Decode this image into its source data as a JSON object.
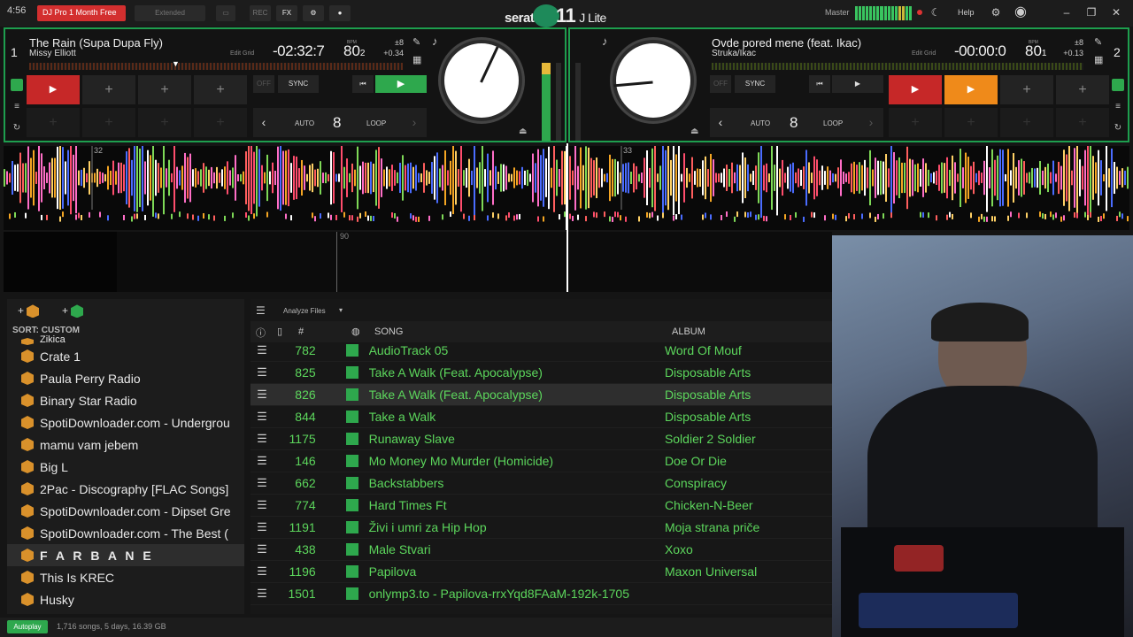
{
  "topbar": {
    "time": "4:56",
    "promo": "DJ Pro 1 Month Free",
    "extended": "Extended",
    "rec": "REC",
    "fx": "FX",
    "logo": "serato",
    "logo_num": "11",
    "logo_suffix": "J Lite",
    "master": "Master",
    "help": "Help"
  },
  "deck1": {
    "number": "1",
    "title": "The Rain (Supa Dupa Fly)",
    "artist": "Missy Elliott",
    "edit_grid": "Edit Grid",
    "time": "-02:32:7",
    "bpm_label": "BPM",
    "bpm": "80",
    "bpm_sub": "2",
    "pitch_range": "±8",
    "pitch": "+0.34",
    "sync": "SYNC",
    "off": "OFF",
    "auto": "AUTO",
    "loop_size": "8",
    "loop": "LOOP"
  },
  "deck2": {
    "number": "2",
    "title": "Ovde pored mene (feat. Ikac)",
    "artist": "Struka/Ikac",
    "edit_grid": "Edit Grid",
    "time": "-00:00:0",
    "bpm_label": "BPM",
    "bpm": "80",
    "bpm_sub": "1",
    "pitch_range": "±8",
    "pitch": "+0.13",
    "sync": "SYNC",
    "off": "OFF",
    "auto": "AUTO",
    "loop_size": "8",
    "loop": "LOOP"
  },
  "wave": {
    "bar1": "32",
    "bar2": "33",
    "mark": "90"
  },
  "library": {
    "sort": "SORT: CUSTOM",
    "analyze": "Analyze Files",
    "crates": [
      "Zikica",
      "Crate 1",
      "Paula Perry Radio",
      "Binary Star Radio",
      "SpotiDownloader.com - Undergrou",
      "mamu vam jebem",
      "Big L",
      "2Pac - Discography [FLAC Songs]",
      "SpotiDownloader.com - Dipset Gre",
      "SpotiDownloader.com - The Best (",
      "F A R B A N E",
      "This Is KREC",
      "Husky"
    ],
    "columns": {
      "num": "#",
      "song": "SONG",
      "album": "ALBUM"
    },
    "rows": [
      {
        "num": "782",
        "song": "AudioTrack 05",
        "album": "Word Of Mouf"
      },
      {
        "num": "825",
        "song": "Take A Walk (Feat. Apocalypse)",
        "album": "Disposable Arts"
      },
      {
        "num": "826",
        "song": "Take A Walk (Feat. Apocalypse)",
        "album": "Disposable Arts"
      },
      {
        "num": "844",
        "song": "Take a Walk",
        "album": "Disposable Arts"
      },
      {
        "num": "1175",
        "song": "Runaway Slave",
        "album": "Soldier 2 Soldier"
      },
      {
        "num": "146",
        "song": "Mo Money Mo Murder (Homicide)",
        "album": "Doe Or Die"
      },
      {
        "num": "662",
        "song": "Backstabbers",
        "album": "Conspiracy"
      },
      {
        "num": "774",
        "song": "Hard Times Ft",
        "album": "Chicken-N-Beer"
      },
      {
        "num": "1191",
        "song": "Živi i umri za Hip Hop",
        "album": "Moja strana priče"
      },
      {
        "num": "438",
        "song": "Male Stvari",
        "album": "Xoxo"
      },
      {
        "num": "1196",
        "song": "Papilova",
        "album": "Maxon Universal"
      },
      {
        "num": "1501",
        "song": "onlymp3.to - Papilova-rrxYqd8FAaM-192k-1705",
        "album": ""
      }
    ],
    "status": "1,716 songs, 5 days, 16.39 GB",
    "autoplay": "Autoplay"
  },
  "colors": {
    "accent": "#2ea84d",
    "track_text": "#5cd65c",
    "cue_red": "#c62828",
    "cue_orange": "#ef8a1a"
  }
}
